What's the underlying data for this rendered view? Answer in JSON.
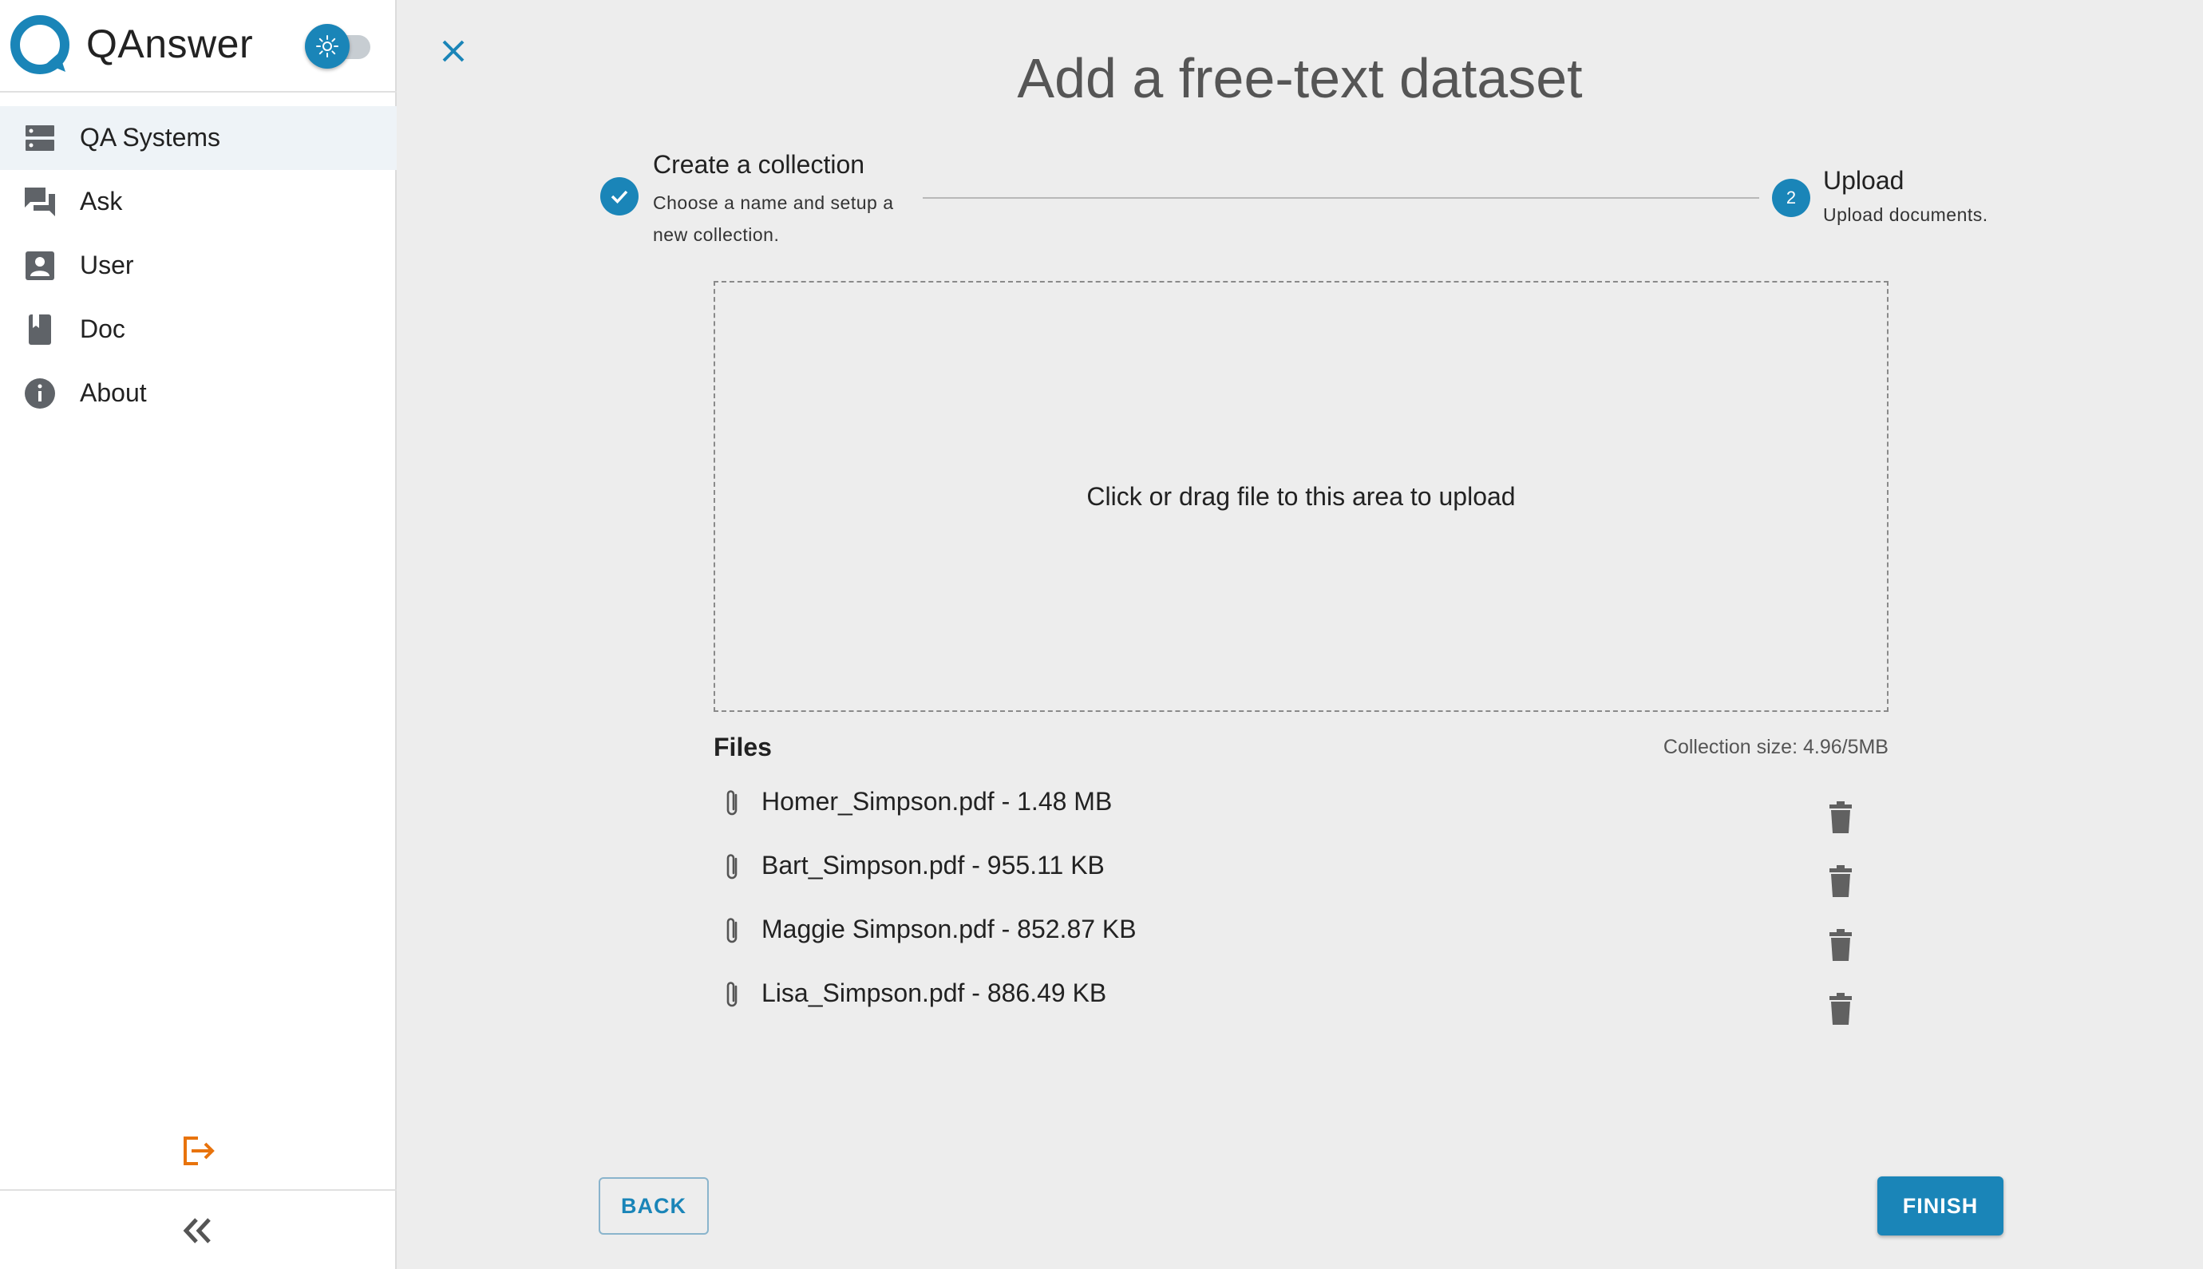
{
  "app": {
    "name": "QAnswer"
  },
  "theme_toggle": {
    "icon": "sun-icon",
    "state": "light"
  },
  "sidebar": {
    "items": [
      {
        "label": "QA Systems",
        "icon": "server-icon",
        "active": true
      },
      {
        "label": "Ask",
        "icon": "chat-icon",
        "active": false
      },
      {
        "label": "User",
        "icon": "user-icon",
        "active": false
      },
      {
        "label": "Doc",
        "icon": "book-icon",
        "active": false
      },
      {
        "label": "About",
        "icon": "info-icon",
        "active": false
      }
    ],
    "logout_icon": "logout-icon",
    "collapse_icon": "double-chevron-left-icon"
  },
  "page": {
    "title": "Add a free-text dataset"
  },
  "stepper": {
    "steps": [
      {
        "title": "Create a collection",
        "subtitle": "Choose a name and setup a new collection.",
        "state": "completed"
      },
      {
        "number": "2",
        "title": "Upload",
        "subtitle": "Upload documents.",
        "state": "active"
      }
    ]
  },
  "upload": {
    "dropzone_text": "Click or drag file to this area to upload"
  },
  "files": {
    "heading": "Files",
    "collection_size": "Collection size: 4.96/5MB",
    "items": [
      {
        "label": "Homer_Simpson.pdf - 1.48 MB"
      },
      {
        "label": "Bart_Simpson.pdf - 955.11 KB"
      },
      {
        "label": "Maggie Simpson.pdf - 852.87 KB"
      },
      {
        "label": "Lisa_Simpson.pdf - 886.49 KB"
      }
    ]
  },
  "actions": {
    "back": "BACK",
    "finish": "FINISH"
  },
  "colors": {
    "accent": "#1a85b8",
    "logout": "#e8730c",
    "background": "#ededed"
  }
}
